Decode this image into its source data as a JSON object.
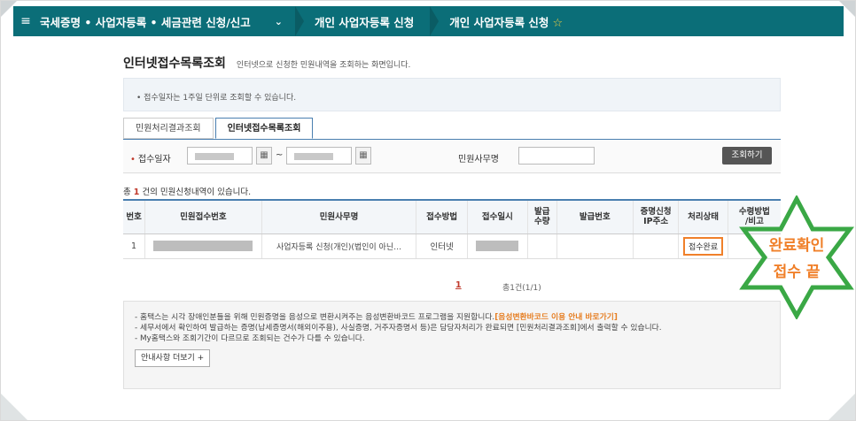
{
  "nav": {
    "section": "국세증명 • 사업자등록 • 세금관련 신청/신고",
    "crumb2": "개인 사업자등록 신청",
    "crumb3": "개인 사업자등록 신청"
  },
  "page": {
    "title": "인터넷접수목록조회",
    "description": "인터넷으로 신청한 민원내역을 조회하는 화면입니다.",
    "info": "접수일자는 1주일 단위로 조회할 수 있습니다."
  },
  "tabs": [
    {
      "label": "민원처리결과조회"
    },
    {
      "label": "인터넷접수목록조회"
    }
  ],
  "search": {
    "date_label": "접수일자",
    "tilde": "~",
    "name_label": "민원사무명",
    "button": "조회하기"
  },
  "result": {
    "prefix": "총",
    "count": "1",
    "suffix": "건의 민원신청내역이 있습니다."
  },
  "table": {
    "headers": [
      "번호",
      "민원접수번호",
      "민원사무명",
      "접수방법",
      "접수일시",
      "발급\n수량",
      "발급번호",
      "증명신청\nIP주소",
      "처리상태",
      "수령방법\n/비고"
    ],
    "rows": [
      {
        "no": "1",
        "service": "사업자등록 신청(개인)(법인이 아닌…",
        "method": "인터넷",
        "status": "접수완료"
      }
    ]
  },
  "pager": {
    "current": "1",
    "summary": "총1건(1/1)"
  },
  "notice": {
    "line1": "- 홈택스는 시각 장애인분들을 위해 민원증명을 음성으로 변환시켜주는 음성변환바코드 프로그램을 지원합니다.",
    "line1_link": "[음성변환바코드 이용 안내 바로가기]",
    "line2": "- 세무서에서 확인하여 발급하는 증명(납세증명서(해외이주용), 사실증명, 거주자증명서 등)은 담당자처리가 완료되면 [민원처리결과조회]에서 출력할 수 있습니다.",
    "line3": "- My홈택스와 조회기간이 다르므로 조회되는 건수가 다를 수 있습니다.",
    "more_button": "안내사항 더보기 +"
  },
  "annotation": {
    "line1": "완료확인",
    "line2": "접수 끝",
    "color": "#f0802a",
    "star_color": "#3aa845"
  }
}
